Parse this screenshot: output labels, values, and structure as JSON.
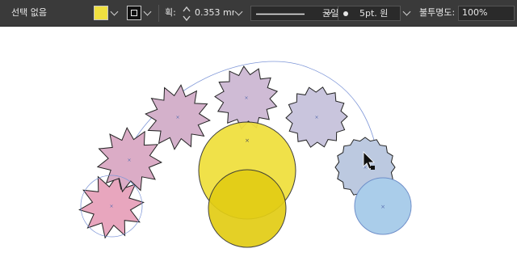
{
  "toolbar": {
    "selection_label": "선택 없음",
    "fill_color": "#f0e040",
    "stroke_label": "획:",
    "stroke_weight": "0.353 mn",
    "stroke_profile": "균일",
    "brush": "5pt. 원",
    "opacity_label": "불투명도:",
    "opacity_value": "100%"
  },
  "canvas": {
    "stars_fill": [
      "#e8a6be",
      "#dbacc6",
      "#d4b1cb",
      "#cfbbd5",
      "#c9c5dd",
      "#bcc9e0"
    ],
    "circle_fill": "#aacdea",
    "yellow_fill": "#f0e040",
    "path_color": "#7f97d8",
    "cursor_icon": "arrow-cursor-icon"
  }
}
